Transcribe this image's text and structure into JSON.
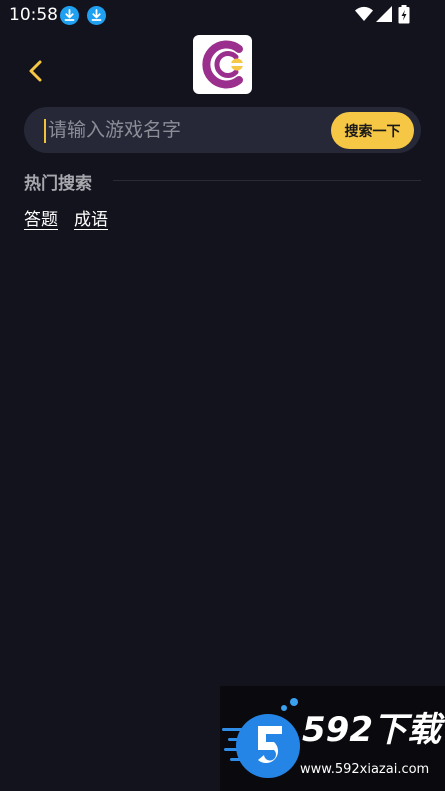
{
  "status_bar": {
    "time": "10:58",
    "icons": [
      "download-icon",
      "download-icon",
      "wifi-icon",
      "signal-icon",
      "battery-icon"
    ]
  },
  "header": {
    "back_icon": "chevron-left-icon",
    "logo_icon": "app-logo-icon"
  },
  "search": {
    "placeholder": "请输入游戏名字",
    "value": "",
    "button_label": "搜索一下"
  },
  "hot_search": {
    "title": "热门搜索",
    "tags": [
      {
        "label": "答题"
      },
      {
        "label": "成语"
      }
    ]
  },
  "watermark": {
    "brand": "592下载",
    "url": "www.592xiazai.com"
  },
  "colors": {
    "background": "#13131d",
    "accent": "#f6c744",
    "search_bg": "#262837",
    "logo_purple": "#9b2f8e"
  }
}
